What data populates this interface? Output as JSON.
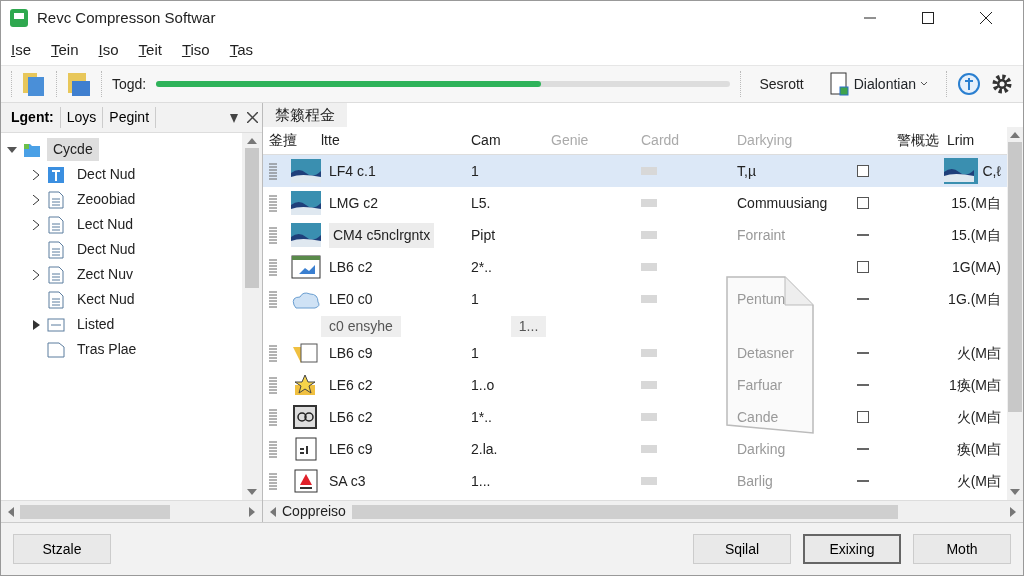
{
  "window": {
    "title": "Revc Compresson Softwar"
  },
  "menu": [
    "Ise",
    "Tein",
    "Iso",
    "Teit",
    "Tiso",
    "Tas"
  ],
  "toolbar": {
    "progress_label": "Togd:",
    "level": 0.67,
    "status": "Sesrott",
    "dropdown": "Dialontian"
  },
  "sidebar": {
    "tabs": [
      {
        "label": "Lgent:",
        "selected": true
      },
      {
        "label": "Loys",
        "selected": false
      },
      {
        "label": "Pegint",
        "selected": false
      }
    ],
    "tree": [
      {
        "label": "Cycde",
        "expanded": true,
        "selected": true,
        "children": [
          {
            "label": "Dect Nud",
            "expandable": true,
            "kind": "app"
          },
          {
            "label": "Zeoobiad",
            "expandable": true,
            "kind": "doc"
          },
          {
            "label": "Lect Nud",
            "expandable": true,
            "kind": "doc"
          },
          {
            "label": "Dect Nud",
            "expandable": false,
            "kind": "doc"
          },
          {
            "label": "Zect Nuv",
            "expandable": true,
            "kind": "doc"
          },
          {
            "label": "Kect Nud",
            "expandable": false,
            "kind": "doc"
          },
          {
            "label": "Listed",
            "expandable": true,
            "kind": "list"
          },
          {
            "label": "Tras Plae",
            "expandable": false,
            "kind": "page"
          }
        ]
      }
    ]
  },
  "section_title": "禁籁程金",
  "table": {
    "columns": [
      "釜擅",
      "ltte",
      "Cam",
      "Genie",
      "Cardd",
      "Darkying",
      "",
      "警概选",
      "Lrim"
    ],
    "rows": [
      {
        "kind": "landscape",
        "name": "LF4 c.1",
        "cam": "1",
        "darkying": "T,µ",
        "indeterminate": false,
        "size": "C,ℓ",
        "thumb": true,
        "selected": true,
        "highlight": false
      },
      {
        "kind": "landscape",
        "name": "LMG c2",
        "cam": "L5.",
        "darkying": "Commuusiang",
        "indeterminate": false,
        "size": "15.(M自",
        "selected": false,
        "highlight": false
      },
      {
        "kind": "landscape",
        "name": "CM4 c5nclrgntx",
        "cam": "Pipt",
        "darkying": "Forraint",
        "indeterminate": true,
        "size": "15.(M自",
        "selected": false,
        "highlight": true
      },
      {
        "kind": "chart",
        "name": "LB6 c2",
        "cam": "2*..",
        "darkying": "",
        "indeterminate": false,
        "size": "1G(MA)",
        "selected": false,
        "highlight": false
      },
      {
        "kind": "cloud",
        "name": "LE0 c0",
        "cam": "1",
        "darkying": "Pentum",
        "indeterminate": true,
        "size": "1G.(M自",
        "selected": false,
        "highlight": false
      },
      {
        "kind": "triangle",
        "name": "LB6 c9",
        "cam": "1",
        "darkying": "Detasner",
        "indeterminate": true,
        "size": "火(M卣",
        "selected": false,
        "highlight": false
      },
      {
        "kind": "star",
        "name": "LE6 c2",
        "cam": "1..o",
        "darkying": "Farfuar",
        "indeterminate": true,
        "size": "1痪(M卣",
        "selected": false,
        "highlight": false
      },
      {
        "kind": "badge",
        "name": "LБ6 c2",
        "cam": "1*..",
        "darkying": "Cande",
        "indeterminate": false,
        "size": "火(M卣",
        "selected": false,
        "highlight": false
      },
      {
        "kind": "doc",
        "name": "LE6 c9",
        "cam": "2.la.",
        "darkying": "Darking",
        "indeterminate": true,
        "size": "痪(M卣",
        "selected": false,
        "highlight": false
      },
      {
        "kind": "warning",
        "name": "SA c3",
        "cam": "1...",
        "darkying": "Barlig",
        "indeterminate": true,
        "size": "火(M卣",
        "selected": false,
        "highlight": false
      }
    ]
  },
  "tooltip": {
    "text": "c0 ensyhe",
    "value": "1..."
  },
  "scroll_label": "Coppreiso",
  "buttons": [
    {
      "label": "Stzale",
      "default": false
    },
    {
      "label": "Sqilal",
      "default": false
    },
    {
      "label": "Exixing",
      "default": true
    },
    {
      "label": "Moth",
      "default": false
    }
  ]
}
